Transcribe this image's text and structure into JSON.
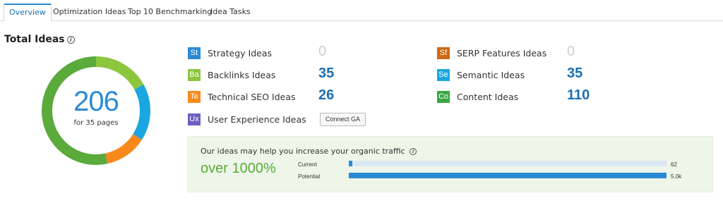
{
  "tabs": [
    {
      "label": "Overview",
      "active": true
    },
    {
      "label": "Optimization Ideas",
      "active": false
    },
    {
      "label": "Top 10 Benchmarking",
      "active": false
    },
    {
      "label": "Idea Tasks",
      "active": false
    }
  ],
  "summary": {
    "title": "Total Ideas",
    "info_icon": "i",
    "total": "206",
    "pages_text": "for 35 pages"
  },
  "donut_segments": [
    {
      "name": "Backlinks Ideas",
      "value": 35,
      "color": "#8cc63f"
    },
    {
      "name": "Semantic Ideas",
      "value": 35,
      "color": "#1aa6e0"
    },
    {
      "name": "Technical SEO Ideas",
      "value": 26,
      "color": "#f7891c"
    },
    {
      "name": "Content Ideas",
      "value": 110,
      "color": "#5aaa3c"
    }
  ],
  "ideas": {
    "strategy": {
      "badge": "St",
      "label": "Strategy Ideas",
      "value": "0",
      "color": "#2b8ad4"
    },
    "backlinks": {
      "badge": "Ba",
      "label": "Backlinks Ideas",
      "value": "35",
      "color": "#8cc63f"
    },
    "technical": {
      "badge": "Te",
      "label": "Technical SEO Ideas",
      "value": "26",
      "color": "#f7891c"
    },
    "ux": {
      "badge": "Ux",
      "label": "User Experience Ideas",
      "color": "#6b5fc1"
    },
    "serp": {
      "badge": "Sf",
      "label": "SERP Features Ideas",
      "value": "0",
      "color": "#cd6a13"
    },
    "semantic": {
      "badge": "Se",
      "label": "Semantic Ideas",
      "value": "35",
      "color": "#1aa6e0"
    },
    "content": {
      "badge": "Co",
      "label": "Content Ideas",
      "value": "110",
      "color": "#3aa845"
    }
  },
  "connect_button": "Connect GA",
  "traffic": {
    "title": "Our ideas may help you increase your organic traffic",
    "info_icon": "i",
    "increase": "over 1000%",
    "current": {
      "label": "Current",
      "value": "62",
      "fraction": 0.012
    },
    "potential": {
      "label": "Potential",
      "value": "5.0k",
      "fraction": 1.0
    }
  }
}
